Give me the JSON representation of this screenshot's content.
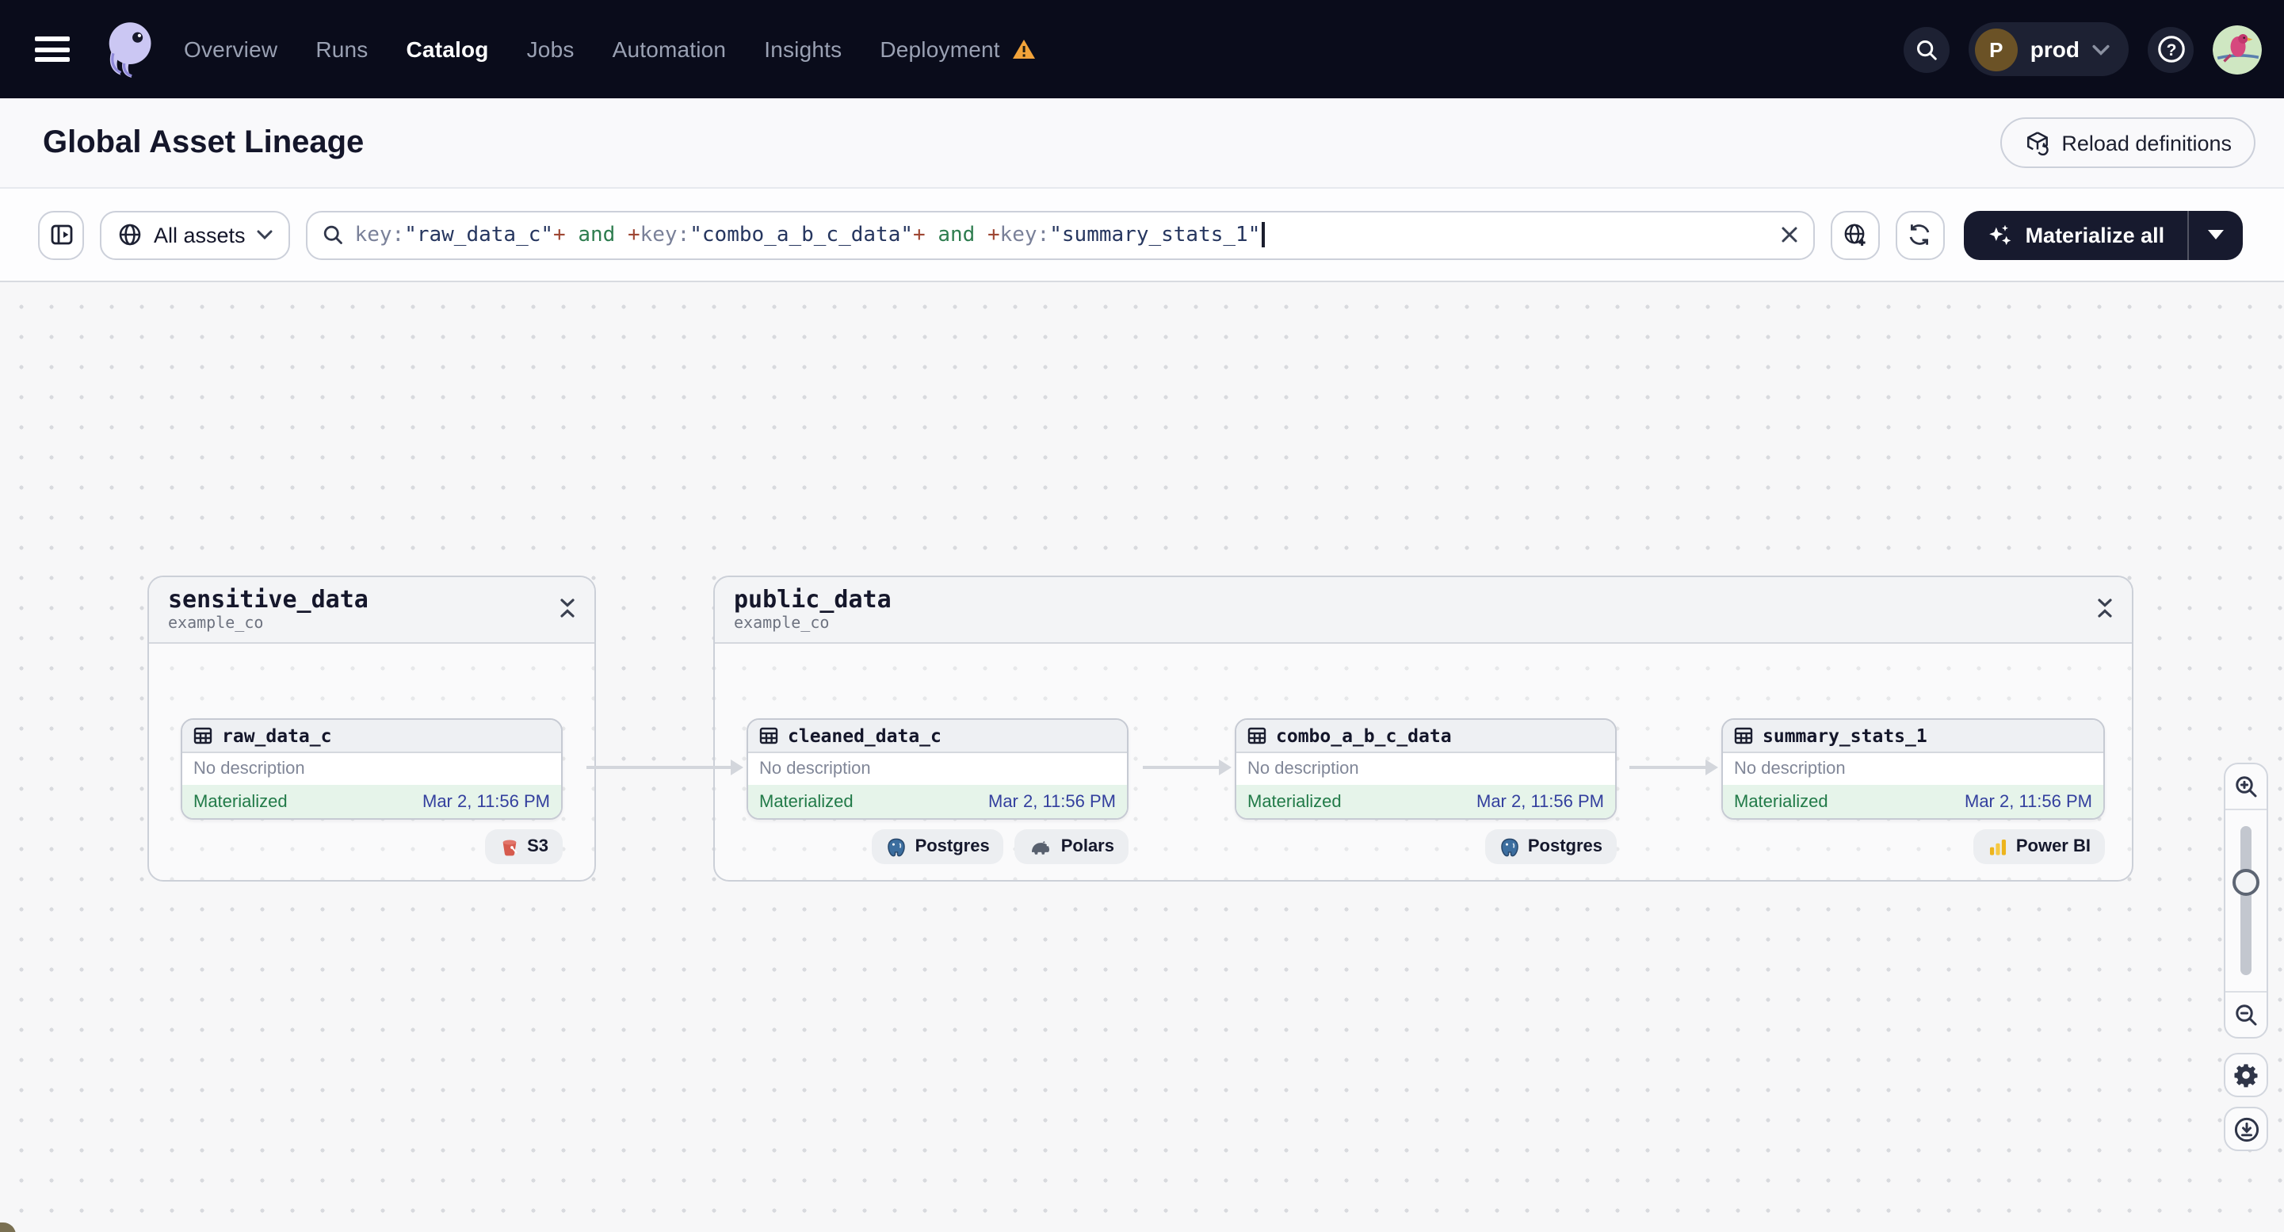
{
  "nav": {
    "items": [
      {
        "label": "Overview"
      },
      {
        "label": "Runs"
      },
      {
        "label": "Catalog"
      },
      {
        "label": "Jobs"
      },
      {
        "label": "Automation"
      },
      {
        "label": "Insights"
      },
      {
        "label": "Deployment"
      }
    ],
    "active_item": "Catalog",
    "environment": {
      "initial": "P",
      "name": "prod"
    }
  },
  "header": {
    "title": "Global Asset Lineage",
    "reload_label": "Reload definitions"
  },
  "toolbar": {
    "scope_label": "All assets",
    "materialize_label": "Materialize all",
    "query_parts": [
      {
        "text": "key:"
      },
      {
        "text": "\"raw_data_c\""
      },
      {
        "text": "+"
      },
      {
        "text": " and "
      },
      {
        "text": "+"
      },
      {
        "text": "key:"
      },
      {
        "text": "\"combo_a_b_c_data\""
      },
      {
        "text": "+"
      },
      {
        "text": " and "
      },
      {
        "text": "+"
      },
      {
        "text": "key:"
      },
      {
        "text": "\"summary_stats_1\""
      }
    ]
  },
  "graph": {
    "groups": [
      {
        "name": "sensitive_data",
        "location": "example_co"
      },
      {
        "name": "public_data",
        "location": "example_co"
      }
    ],
    "assets": [
      {
        "name": "raw_data_c",
        "description": "No description",
        "status": "Materialized",
        "timestamp": "Mar 2, 11:56 PM",
        "badges": [
          {
            "label": "S3"
          }
        ]
      },
      {
        "name": "cleaned_data_c",
        "description": "No description",
        "status": "Materialized",
        "timestamp": "Mar 2, 11:56 PM",
        "badges": [
          {
            "label": "Postgres"
          },
          {
            "label": "Polars"
          }
        ]
      },
      {
        "name": "combo_a_b_c_data",
        "description": "No description",
        "status": "Materialized",
        "timestamp": "Mar 2, 11:56 PM",
        "badges": [
          {
            "label": "Postgres"
          }
        ]
      },
      {
        "name": "summary_stats_1",
        "description": "No description",
        "status": "Materialized",
        "timestamp": "Mar 2, 11:56 PM",
        "badges": [
          {
            "label": "Power BI"
          }
        ]
      }
    ]
  },
  "colors": {
    "status_green": "#217a48",
    "status_bg": "#e6f4ea",
    "timestamp_blue": "#333f9e",
    "warning_orange": "#f2a33a",
    "nav_bg": "#0a0c1b",
    "materialize_bg": "#171a2e"
  }
}
